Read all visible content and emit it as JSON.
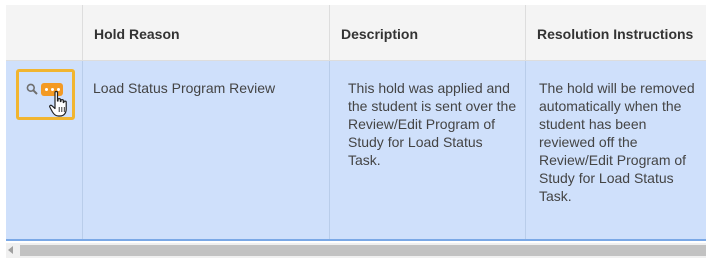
{
  "grid": {
    "columns": [
      {
        "label": ""
      },
      {
        "label": "Hold Reason"
      },
      {
        "label": "Description"
      },
      {
        "label": "Resolution Instructions"
      }
    ],
    "rows": [
      {
        "hold_reason": "Load Status Program Review",
        "description": "This hold was applied and the student is sent over the Review/Edit Program of Study for Load Status Task.",
        "resolution": "The hold will be removed automatically when the student has been reviewed off the Review/Edit Program of Study for Load Status Task."
      }
    ],
    "row_actions": {
      "view_icon": "search-icon",
      "more_icon": "more-options-icon"
    },
    "cursor": "hand-pointer-cursor"
  },
  "colors": {
    "selected_row": "#cfe0fb",
    "header_bg": "#f4f4f4",
    "highlight": "#f1b530",
    "action_button": "#f39a24"
  }
}
